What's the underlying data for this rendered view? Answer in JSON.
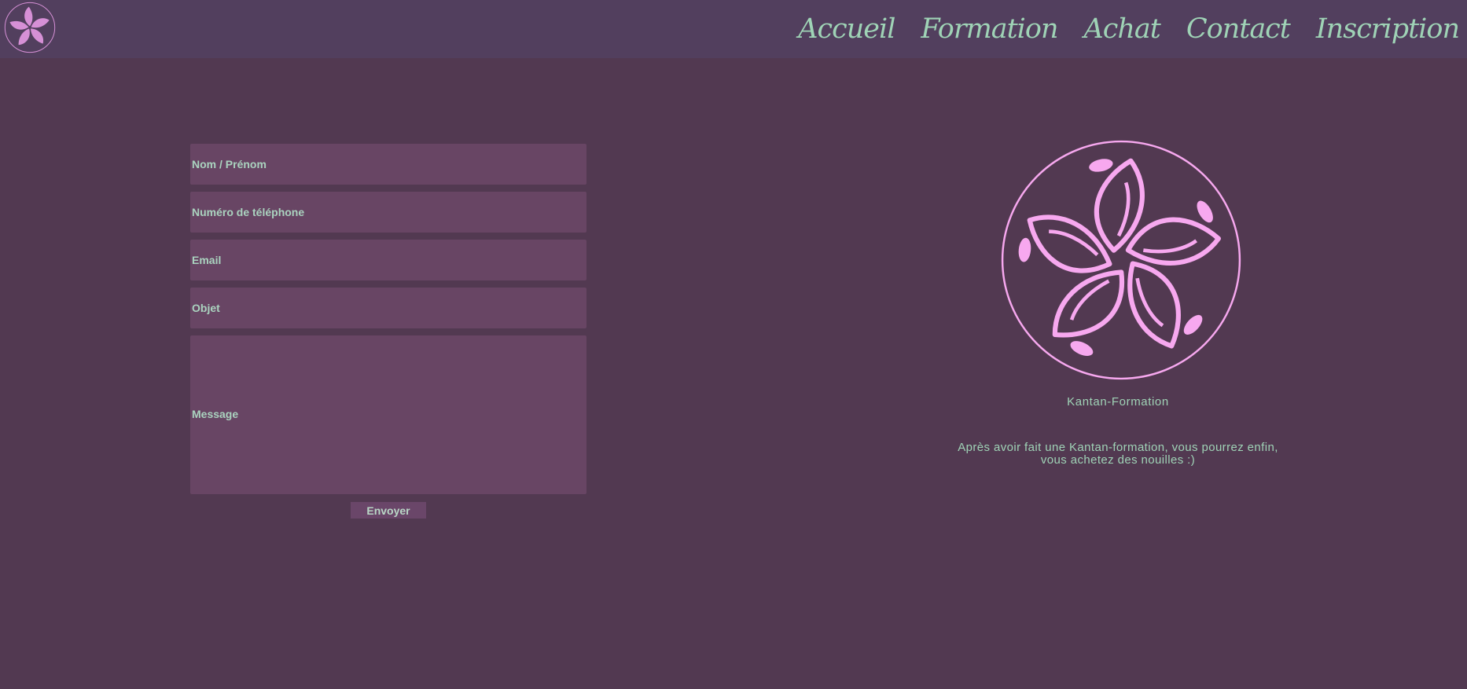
{
  "nav": {
    "items": [
      {
        "label": "Accueil"
      },
      {
        "label": "Formation"
      },
      {
        "label": "Achat"
      },
      {
        "label": "Contact"
      },
      {
        "label": "Inscription"
      }
    ]
  },
  "form": {
    "name_placeholder": "Nom / Prénom",
    "phone_placeholder": "Numéro de téléphone",
    "email_placeholder": "Email",
    "subject_placeholder": "Objet",
    "message_placeholder": "Message",
    "submit_label": "Envoyer"
  },
  "brand": {
    "name": "Kantan-Formation",
    "tagline_line1": "Après avoir fait une Kantan-formation, vous pourrez enfin,",
    "tagline_line2": "vous achetez des nouilles :)"
  },
  "colors": {
    "background": "#523951",
    "header": "#523f5e",
    "accent_text": "#9fd3b6",
    "logo_pink": "#f7a8ef",
    "input_bg": "#684564"
  },
  "icons": {
    "logo": "lotus-flower-logo"
  }
}
